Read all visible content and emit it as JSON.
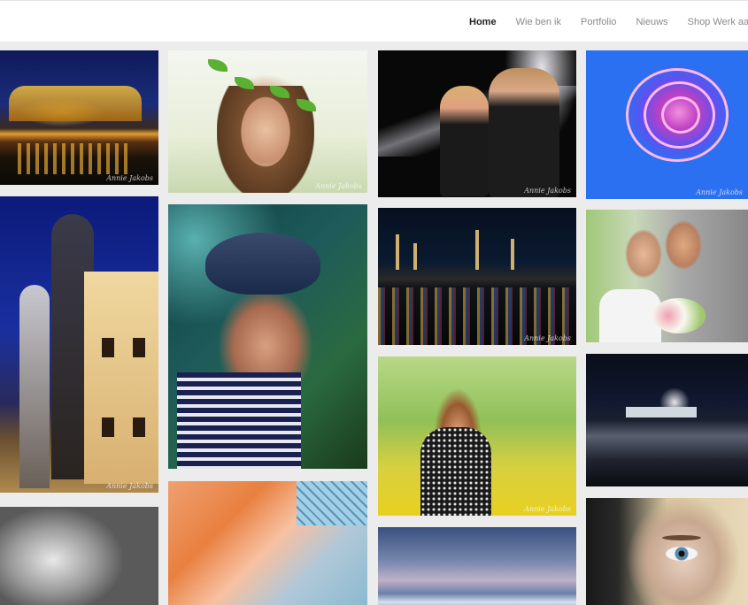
{
  "nav": {
    "items": [
      {
        "label": "Home",
        "active": true
      },
      {
        "label": "Wie ben ik",
        "active": false
      },
      {
        "label": "Portfolio",
        "active": false
      },
      {
        "label": "Nieuws",
        "active": false
      },
      {
        "label": "Shop Werk aan de"
      }
    ]
  },
  "gallery": {
    "watermark": "Annie Jakobs",
    "photos": [
      {
        "subject": "city-night-reflection"
      },
      {
        "subject": "tower-building-night"
      },
      {
        "subject": "baby-black-white"
      },
      {
        "subject": "girl-leaf-crown"
      },
      {
        "subject": "girl-blue-hat"
      },
      {
        "subject": "modern-architecture-orange"
      },
      {
        "subject": "couple-black-veil"
      },
      {
        "subject": "industry-night-reflection"
      },
      {
        "subject": "girl-yellow-flowers"
      },
      {
        "subject": "beach-sunset-sky"
      },
      {
        "subject": "pink-carnation-blue"
      },
      {
        "subject": "wedding-couple"
      },
      {
        "subject": "harbor-ship-night"
      },
      {
        "subject": "woman-blue-eye"
      }
    ]
  },
  "colors": {
    "background": "#ececec",
    "nav_active": "#222222",
    "nav_inactive": "#8a8a8a"
  }
}
